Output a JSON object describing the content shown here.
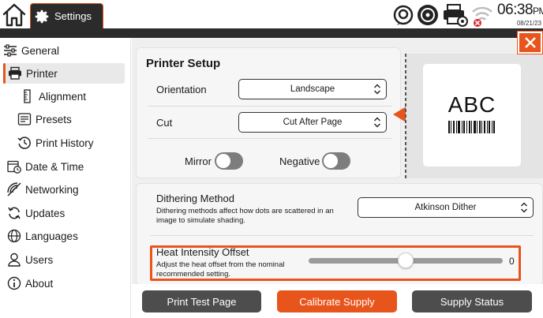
{
  "topbar": {
    "active_tab": "Settings",
    "time": "06:38",
    "ampm": "PM",
    "date": "08/21/23"
  },
  "sidebar": {
    "items": [
      {
        "label": "General",
        "icon": "sliders-icon"
      },
      {
        "label": "Printer",
        "icon": "printer-icon",
        "active": true
      },
      {
        "label": "Alignment",
        "icon": "ruler-icon"
      },
      {
        "label": "Presets",
        "icon": "presets-icon"
      },
      {
        "label": "Print History",
        "icon": "history-icon"
      },
      {
        "label": "Date & Time",
        "icon": "calendar-clock-icon"
      },
      {
        "label": "Networking",
        "icon": "network-icon"
      },
      {
        "label": "Updates",
        "icon": "refresh-icon"
      },
      {
        "label": "Languages",
        "icon": "globe-icon"
      },
      {
        "label": "Users",
        "icon": "user-icon"
      },
      {
        "label": "About",
        "icon": "info-icon"
      }
    ]
  },
  "printer_setup": {
    "title": "Printer Setup",
    "orientation_label": "Orientation",
    "orientation_value": "Landscape",
    "cut_label": "Cut",
    "cut_value": "Cut After Page",
    "mirror_label": "Mirror",
    "mirror_on": false,
    "negative_label": "Negative",
    "negative_on": false
  },
  "preview": {
    "text": "ABC"
  },
  "dithering": {
    "title": "Dithering Method",
    "description": "Dithering methods affect how dots are scattered in an image to simulate shading.",
    "value": "Atkinson Dither"
  },
  "heat": {
    "title": "Heat Intensity Offset",
    "description": "Adjust the heat offset from the nominal recommended setting.",
    "value": "0",
    "slider_fraction": 0.5
  },
  "footer": {
    "print_test": "Print Test Page",
    "calibrate": "Calibrate Supply",
    "status": "Supply Status"
  },
  "colors": {
    "accent": "#e8551c",
    "dark": "#2b2b2b",
    "button_dark": "#4d4d4d"
  }
}
